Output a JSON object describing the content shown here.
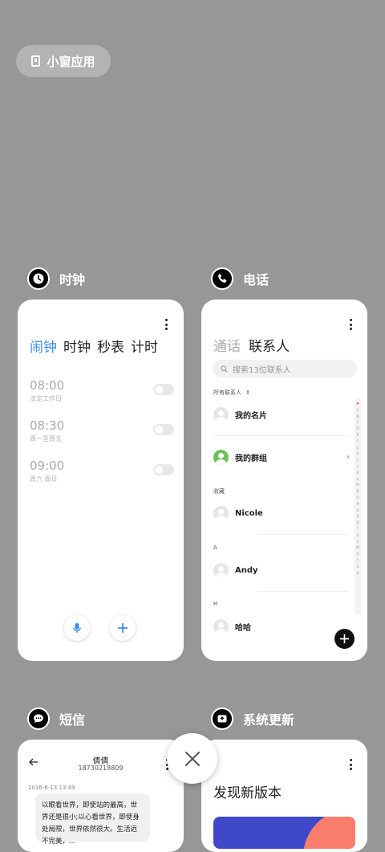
{
  "floating_window": {
    "label": "小窗应用"
  },
  "apps": {
    "clock": {
      "name": "时钟",
      "tabs": [
        "闹钟",
        "时钟",
        "秒表",
        "计时"
      ],
      "active_tab": "闹钟",
      "alarms": [
        {
          "time": "08:00",
          "repeat": "法定工作日",
          "enabled": false
        },
        {
          "time": "08:30",
          "repeat": "周一至周五",
          "enabled": false
        },
        {
          "time": "09:00",
          "repeat": "周六 周日",
          "enabled": false
        }
      ],
      "icon": "clock-icon"
    },
    "phone": {
      "name": "电话",
      "tabs": [
        "通话",
        "联系人"
      ],
      "active_tab": "联系人",
      "search_placeholder": "搜索13位联系人",
      "all_contacts": "所有联系人",
      "my_card": "我的名片",
      "my_groups": "我的群组",
      "favorites_label": "收藏",
      "contacts": [
        {
          "section": "收藏",
          "name": "Nicole"
        },
        {
          "section": "A",
          "name": "Andy"
        },
        {
          "section": "H",
          "name": "哈哈"
        }
      ],
      "alphabet": [
        "♥",
        "A",
        "B",
        "C",
        "D",
        "E",
        "F",
        "G",
        "H",
        "I",
        "J",
        "K",
        "L",
        "M",
        "N",
        "O",
        "P",
        "Q",
        "R",
        "S",
        "T",
        "U",
        "V",
        "W",
        "X",
        "Y",
        "Z",
        "#"
      ],
      "icon": "phone-icon"
    },
    "sms": {
      "name": "短信",
      "contact_name": "倩倩",
      "contact_number": "18730218809",
      "date": "2016-6-13 13:49",
      "message": "以眼看世界，即使站的最高，世界还是很小;以心看世界，即使身处局限，世界依然很大。生活远不完美，...",
      "icon": "chat-icon"
    },
    "update": {
      "name": "系统更新",
      "title": "发现新版本",
      "icon": "update-icon",
      "banner_colors": [
        "#3e48c9",
        "#f97e6e"
      ]
    }
  },
  "colors": {
    "accent": "#3a8ee6",
    "background": "#979797",
    "green": "#6dc15b"
  }
}
